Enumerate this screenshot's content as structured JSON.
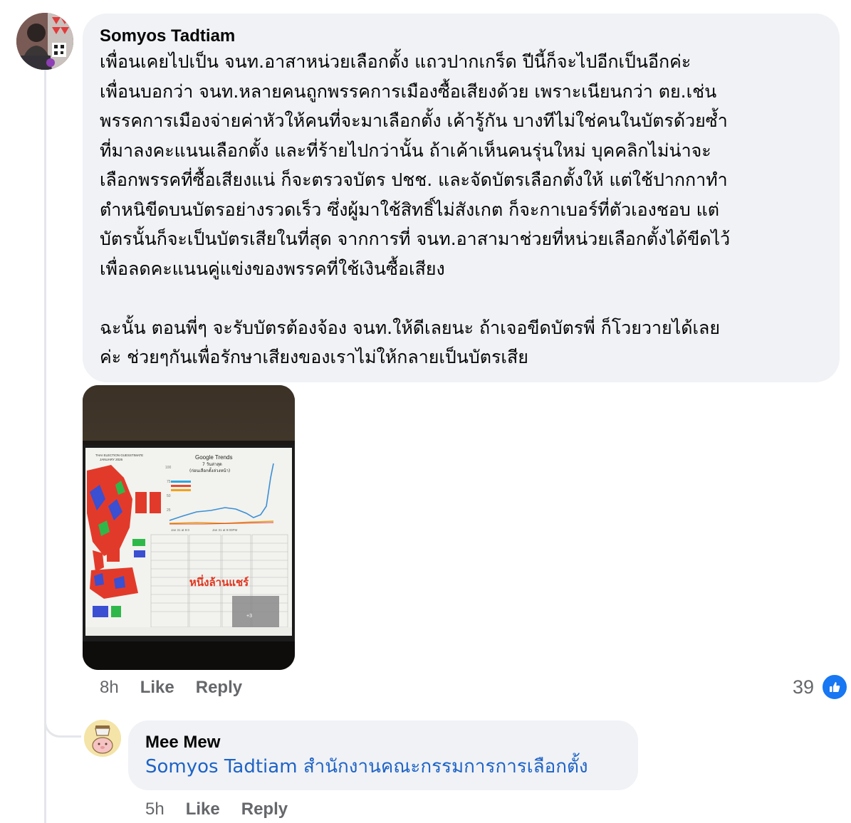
{
  "comment": {
    "author": "Somyos Tadtiam",
    "lines": [
      "เพื่อนเคยไปเป็น จนท.อาสาหน่วยเลือกตั้ง แถวปากเกร็ด  ปีนี้ก็จะไปอีกเป็นอีกค่ะ",
      "เพื่อนบอกว่า จนท.หลายคนถูกพรรคการเมืองซื้อเสียงด้วย เพราะเนียนกว่า    ตย.เช่น",
      "พรรคการเมืองจ่ายค่าหัวให้คนที่จะมาเลือกตั้ง เค้ารู้กัน  บางทีไม่ใช่คนในบัตรด้วยซ้ำ",
      "ที่มาลงคะแนนเลือกตั้ง   และที่ร้ายไปกว่านั้น  ถ้าเค้าเห็นคนรุ่นใหม่  บุคคลิกไม่น่าจะ",
      "เลือกพรรคที่ซื้อเสียงแน่ ก็จะตรวจบัตร ปชช. และจัดบัตรเลือกตั้งให้ แต่ใช้ปากกาทำ",
      "ตำหนิขีดบนบัตรอย่างรวดเร็ว   ซึ่งผู้มาใช้สิทธิ์ไม่สังเกต ก็จะกาเบอร์ที่ตัวเองชอบ  แต่",
      "บัตรนั้นก็จะเป็นบัตรเสียในที่สุด จากการที่ จนท.อาสามาช่วยที่หน่วยเลือกตั้งได้ขีดไว้",
      "เพื่อลดคะแนนคู่แข่งของพรรคที่ใช้เงินซื้อเสียง",
      "",
      "ฉะนั้น ตอนพี่ๆ จะรับบัตรต้องจ้อง จนท.ให้ดีเลยนะ  ถ้าเจอขีดบัตรพี่ ก็โวยวายได้เลย",
      "ค่ะ  ช่วยๆกันเพื่อรักษาเสียงของเราไม่ให้กลายเป็นบัตรเสีย"
    ],
    "photo": {
      "chart_title": "Google Trends",
      "chart_subtitle": "7 วันล่าสุด",
      "chart_note": "(ก่อนเลือกตั้งล่วงหน้า)",
      "axis_ticks": [
        "100",
        "75",
        "50",
        "25"
      ],
      "date_labels": [
        "Jan 31 at 9:0",
        "Jan 31 at 9:00PM"
      ],
      "overlay_text": "หนึ่งล้านแชร์",
      "sheet_header_1": "THAI ELECTION GUESSTIMATE",
      "sheet_header_2": "JANUARY 2026",
      "more_badge": "+3"
    },
    "time": "8h",
    "like_label": "Like",
    "reply_label": "Reply",
    "reaction_count": "39"
  },
  "reply": {
    "author": "Mee Mew",
    "mention": "Somyos Tadtiam",
    "text": "สำนักงานคณะกรรมการการเลือกตั้ง",
    "time": "5h",
    "like_label": "Like",
    "reply_label": "Reply"
  },
  "colors": {
    "bubble": "#f0f2f5",
    "link": "#1e63c7",
    "meta": "#65676b",
    "like_badge": "#1877f2",
    "thread_line": "#e4e6eb"
  }
}
